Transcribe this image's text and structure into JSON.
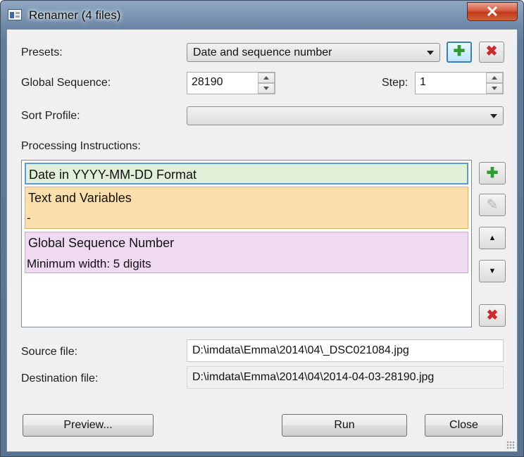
{
  "window": {
    "title": "Renamer (4 files)",
    "close_glyph": "✕"
  },
  "presets": {
    "label": "Presets:",
    "value": "Date and sequence number",
    "add_glyph": "✚",
    "delete_glyph": "✖"
  },
  "sequence": {
    "label": "Global Sequence:",
    "value": "28190",
    "step_label": "Step:",
    "step_value": "1"
  },
  "sort_profile": {
    "label": "Sort Profile:",
    "value": ""
  },
  "instructions": {
    "label": "Processing Instructions:",
    "items": [
      {
        "title": "Date in YYYY-MM-DD Format",
        "subtitle": "",
        "color": "#e2efd9"
      },
      {
        "title": "Text and Variables",
        "subtitle": "-",
        "color": "#fbdfad"
      },
      {
        "title": "Global Sequence Number",
        "subtitle": "Minimum width: 5 digits",
        "color": "#efdaf2"
      }
    ],
    "buttons": {
      "add": "✚",
      "edit": "✎",
      "up": "▲",
      "down": "▼",
      "delete": "✖"
    }
  },
  "files": {
    "source_label": "Source file:",
    "source_value": "D:\\imdata\\Emma\\2014\\04\\_DSC021084.jpg",
    "destination_label": "Destination file:",
    "destination_value": "D:\\imdata\\Emma\\2014\\04\\2014-04-03-28190.jpg"
  },
  "actions": {
    "preview": "Preview...",
    "run": "Run",
    "close": "Close"
  },
  "colors": {
    "accent_focus": "#3c7fb1",
    "add_green": "#2e9b2e",
    "delete_red": "#cc2b2b"
  }
}
